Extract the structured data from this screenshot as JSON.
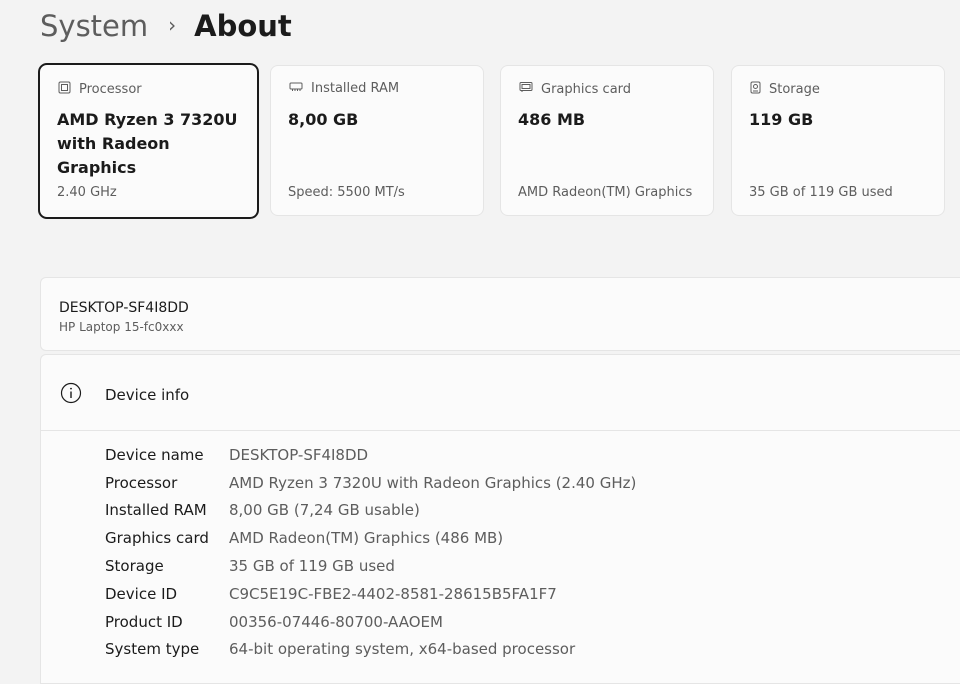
{
  "breadcrumb": {
    "parent": "System",
    "separator": "›",
    "current": "About"
  },
  "cards": [
    {
      "label": "Processor",
      "value": "AMD Ryzen 3 7320U with Radeon Graphics",
      "sub": "2.40 GHz",
      "icon": "processor-icon"
    },
    {
      "label": "Installed RAM",
      "value": "8,00 GB",
      "sub": "Speed: 5500 MT/s",
      "icon": "ram-icon"
    },
    {
      "label": "Graphics card",
      "value": "486 MB",
      "sub": "AMD Radeon(TM) Graphics",
      "icon": "graphics-card-icon"
    },
    {
      "label": "Storage",
      "value": "119 GB",
      "sub": "35 GB of 119 GB used",
      "icon": "storage-icon"
    }
  ],
  "device": {
    "name": "DESKTOP-SF4I8DD",
    "model": "HP Laptop 15-fc0xxx"
  },
  "device_info": {
    "title": "Device info",
    "icon": "info-icon",
    "rows": [
      {
        "label": "Device name",
        "value": "DESKTOP-SF4I8DD"
      },
      {
        "label": "Processor",
        "value": "AMD Ryzen 3 7320U with Radeon Graphics (2.40 GHz)"
      },
      {
        "label": "Installed RAM",
        "value": "8,00 GB (7,24 GB usable)"
      },
      {
        "label": "Graphics card",
        "value": "AMD Radeon(TM) Graphics (486 MB)"
      },
      {
        "label": "Storage",
        "value": "35 GB of 119 GB used"
      },
      {
        "label": "Device ID",
        "value": "C9C5E19C-FBE2-4402-8581-28615B5FA1F7"
      },
      {
        "label": "Product ID",
        "value": "00356-07446-80700-AAOEM"
      },
      {
        "label": "System type",
        "value": "64-bit operating system, x64-based processor"
      }
    ]
  },
  "colors": {
    "background": "#f3f3f3",
    "card": "#fbfbfb",
    "border": "#e5e5e5",
    "text": "#1b1b1b",
    "secondary": "#5d5d5d"
  }
}
